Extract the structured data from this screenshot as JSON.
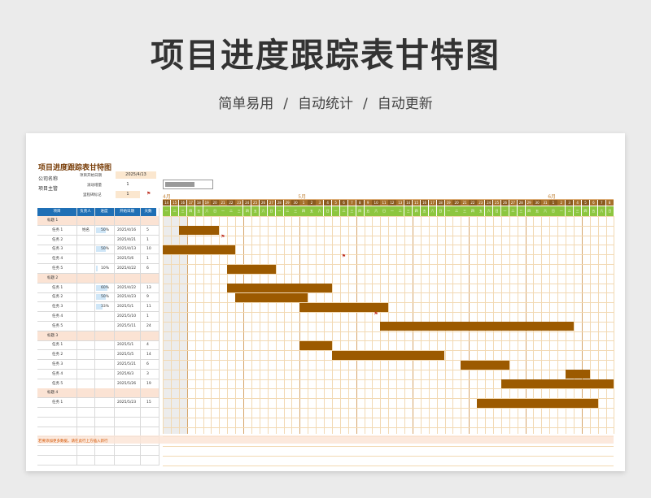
{
  "hero": {
    "title": "项目进度跟踪表甘特图",
    "subtitle_parts": [
      "简单易用",
      "自动统计",
      "自动更新"
    ],
    "separator": "/"
  },
  "sheet": {
    "title": "项目进度跟踪表甘特图",
    "company_label": "公司名称",
    "owner_label": "项目主管",
    "start_date_label": "项目开始日期",
    "start_date_value": "2025/4/13",
    "scroll_label": "滚动增量",
    "scroll_value": "1",
    "milestone_label": "里程碑标记",
    "milestone_value": "1",
    "columns": [
      "项目",
      "负责人",
      "进度",
      "开始日期",
      "天数"
    ],
    "footer_note": "若要添加更多数据，请在此行上方插入新行",
    "months": [
      "4月",
      "5月",
      "6月"
    ],
    "days": [
      "14",
      "15",
      "16",
      "17",
      "18",
      "19",
      "20",
      "21",
      "22",
      "23",
      "24",
      "25",
      "26",
      "27",
      "28",
      "29",
      "30",
      "1",
      "2",
      "3",
      "4",
      "5",
      "6",
      "7",
      "8",
      "9",
      "10",
      "11",
      "12",
      "13",
      "14",
      "15",
      "16",
      "17",
      "18",
      "19",
      "20",
      "21",
      "22",
      "23",
      "24",
      "25",
      "26",
      "27",
      "28",
      "29",
      "30",
      "31",
      "1",
      "2",
      "3",
      "4",
      "5",
      "6",
      "7",
      "8"
    ],
    "weekdays": [
      "一",
      "二",
      "三",
      "四",
      "五",
      "六",
      "日",
      "一",
      "二",
      "三",
      "四",
      "五",
      "六",
      "日",
      "一",
      "二",
      "三",
      "四",
      "五",
      "六",
      "日",
      "一",
      "二",
      "三",
      "四",
      "五",
      "六",
      "日",
      "一",
      "二",
      "三",
      "四",
      "五",
      "六",
      "日",
      "一",
      "二",
      "三",
      "四",
      "五",
      "六",
      "日",
      "一",
      "二",
      "三",
      "四",
      "五",
      "六",
      "日",
      "一",
      "二",
      "三",
      "四",
      "五",
      "六",
      "日"
    ],
    "rows": [
      {
        "type": "group",
        "name": "标题 1"
      },
      {
        "type": "task",
        "name": "任务 1",
        "owner": "姓名",
        "progress": "50%",
        "start": "2025/4/16",
        "days": "5"
      },
      {
        "type": "task",
        "name": "任务 2",
        "owner": "",
        "progress": "",
        "start": "2025/4/21",
        "days": "1"
      },
      {
        "type": "task",
        "name": "任务 3",
        "owner": "",
        "progress": "50%",
        "start": "2025/4/13",
        "days": "10"
      },
      {
        "type": "task",
        "name": "任务 4",
        "owner": "",
        "progress": "",
        "start": "2025/5/6",
        "days": "1"
      },
      {
        "type": "task",
        "name": "任务 5",
        "owner": "",
        "progress": "10%",
        "start": "2025/4/22",
        "days": "6"
      },
      {
        "type": "group",
        "name": "标题 2"
      },
      {
        "type": "task",
        "name": "任务 1",
        "owner": "",
        "progress": "60%",
        "start": "2025/4/22",
        "days": "13"
      },
      {
        "type": "task",
        "name": "任务 2",
        "owner": "",
        "progress": "50%",
        "start": "2025/4/23",
        "days": "9"
      },
      {
        "type": "task",
        "name": "任务 3",
        "owner": "",
        "progress": "33%",
        "start": "2025/5/1",
        "days": "11"
      },
      {
        "type": "task",
        "name": "任务 4",
        "owner": "",
        "progress": "",
        "start": "2025/5/10",
        "days": "1"
      },
      {
        "type": "task",
        "name": "任务 5",
        "owner": "",
        "progress": "",
        "start": "2025/5/11",
        "days": "24"
      },
      {
        "type": "group",
        "name": "标题 3"
      },
      {
        "type": "task",
        "name": "任务 1",
        "owner": "",
        "progress": "",
        "start": "2025/5/1",
        "days": "4"
      },
      {
        "type": "task",
        "name": "任务 2",
        "owner": "",
        "progress": "",
        "start": "2025/5/5",
        "days": "14"
      },
      {
        "type": "task",
        "name": "任务 3",
        "owner": "",
        "progress": "",
        "start": "2025/5/21",
        "days": "6"
      },
      {
        "type": "task",
        "name": "任务 4",
        "owner": "",
        "progress": "",
        "start": "2025/6/3",
        "days": "3"
      },
      {
        "type": "task",
        "name": "任务 5",
        "owner": "",
        "progress": "",
        "start": "2025/5/26",
        "days": "19"
      },
      {
        "type": "group",
        "name": "标题 4"
      },
      {
        "type": "task",
        "name": "任务 1",
        "owner": "",
        "progress": "",
        "start": "2025/5/23",
        "days": "15"
      }
    ]
  },
  "colors": {
    "bar": "#9c5a00",
    "header_blue": "#1f6fb5",
    "weekday_green": "#8dc63f",
    "group_fill": "#fbe3d4"
  }
}
